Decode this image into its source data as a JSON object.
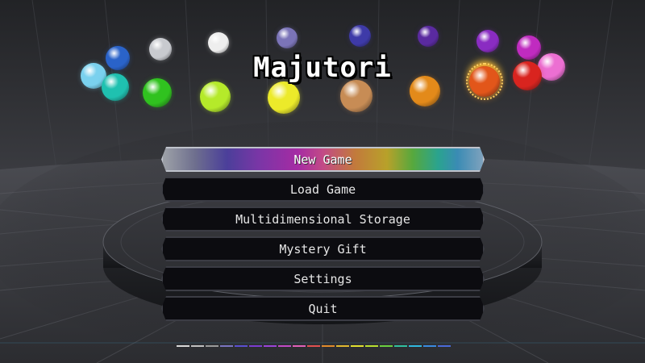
{
  "game": {
    "title": "Majutori"
  },
  "menu": {
    "items": [
      {
        "label": "New Game",
        "selected": true
      },
      {
        "label": "Load Game",
        "selected": false
      },
      {
        "label": "Multidimensional Storage",
        "selected": false
      },
      {
        "label": "Mystery Gift",
        "selected": false
      },
      {
        "label": "Settings",
        "selected": false
      },
      {
        "label": "Quit",
        "selected": false
      }
    ]
  },
  "orbs": [
    {
      "name": "silver-orb",
      "color": "#c8cacf"
    },
    {
      "name": "blue-orb",
      "color": "#2a63c9"
    },
    {
      "name": "light-blue-orb",
      "color": "#7ad1ee"
    },
    {
      "name": "teal-orb",
      "color": "#1fc1b0"
    },
    {
      "name": "white-orb",
      "color": "#eeeeee"
    },
    {
      "name": "lavender-orb",
      "color": "#7b74b8"
    },
    {
      "name": "indigo-orb",
      "color": "#3e3aa8"
    },
    {
      "name": "violet-orb",
      "color": "#5a2aa0"
    },
    {
      "name": "purple-orb",
      "color": "#8a2cc2"
    },
    {
      "name": "magenta-orb",
      "color": "#c02bc0"
    },
    {
      "name": "pink-orb",
      "color": "#ec6fd2"
    },
    {
      "name": "green-orb",
      "color": "#30c21f"
    },
    {
      "name": "lime-orb",
      "color": "#b5ea2a"
    },
    {
      "name": "yellow-orb",
      "color": "#ecea2a"
    },
    {
      "name": "bronze-orb",
      "color": "#c78c55"
    },
    {
      "name": "orange-orb",
      "color": "#e38a1a"
    },
    {
      "name": "spiky-orange-orb",
      "color": "#e2561a"
    },
    {
      "name": "red-orb",
      "color": "#d9241f"
    }
  ],
  "page_dots": [
    "#d8d8d8",
    "#c0c0c0",
    "#9a9a9a",
    "#7a74c0",
    "#5a4fd0",
    "#7b3cd0",
    "#9a44d8",
    "#c04ac6",
    "#e060b8",
    "#e05050",
    "#e08a2a",
    "#e0b830",
    "#e0e030",
    "#b8e030",
    "#6ad040",
    "#30c0a0",
    "#30b8e0",
    "#3a8ae0",
    "#4a6ad8"
  ]
}
